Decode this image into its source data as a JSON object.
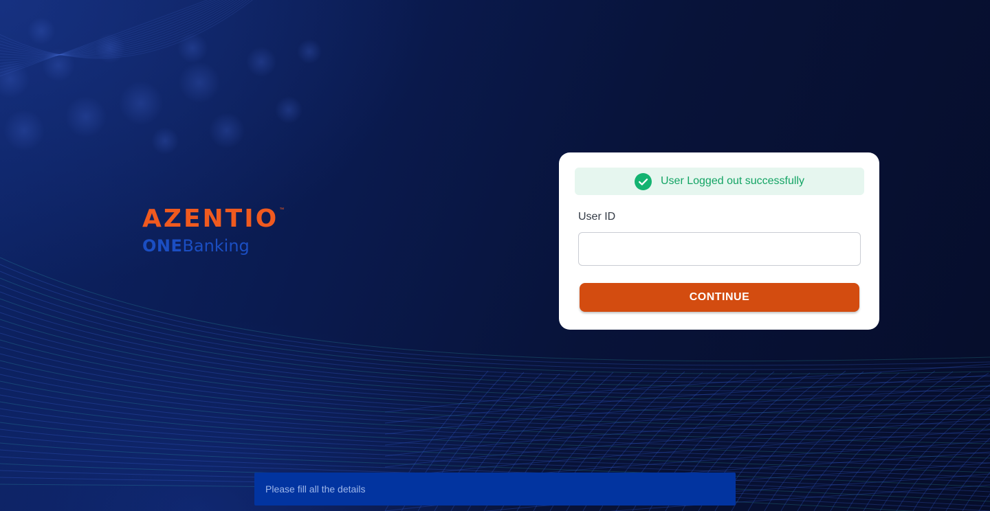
{
  "brand": {
    "logo_text": "AZENTIO",
    "trademark": "™",
    "product_bold": "ONE",
    "product_thin": "Banking",
    "logo_color": "#f05a1f",
    "product_color": "#1b4ec2"
  },
  "login": {
    "alert_icon": "check-circle-icon",
    "alert_message": "User Logged out successfully",
    "user_id_label": "User ID",
    "user_id_value": "",
    "continue_label": "CONTINUE"
  },
  "toast": {
    "message": "Please fill all the details"
  },
  "colors": {
    "accent": "#d34c10",
    "success": "#13a464",
    "success_bg": "#e6f6ef",
    "toast_bg": "#0234a0"
  }
}
